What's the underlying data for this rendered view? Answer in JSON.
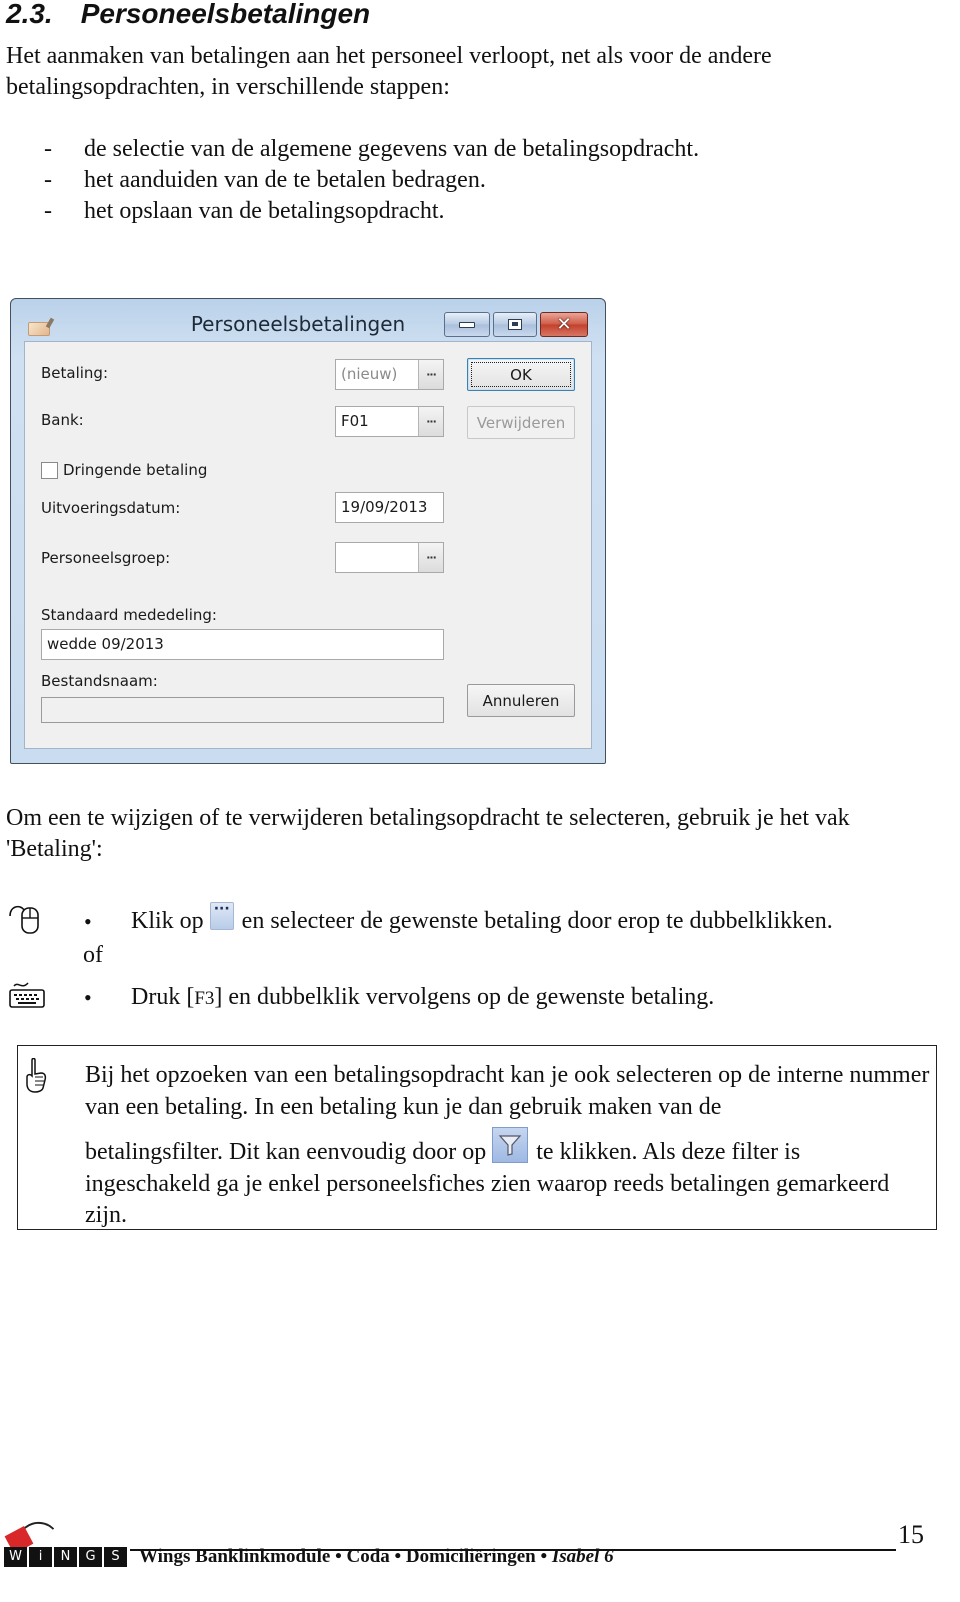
{
  "section": {
    "number": "2.3.",
    "title": "Personeelsbetalingen"
  },
  "intro": "Het aanmaken van betalingen aan het personeel verloopt, net als voor de andere betalingsopdrachten, in verschillende stappen:",
  "steps": [
    {
      "marker": "-",
      "text": "de selectie van de algemene gegevens van de betalingsopdracht."
    },
    {
      "marker": "-",
      "text": "het aanduiden van de te betalen bedragen."
    },
    {
      "marker": "-",
      "text": "het opslaan van de betalingsopdracht."
    }
  ],
  "dialog": {
    "title": "Personeelsbetalingen",
    "icons": {
      "app": "envelope-icon",
      "minimize": "minimize-icon",
      "maximize": "maximize-icon",
      "close": "close-icon",
      "close_glyph": "✕"
    },
    "browse_glyph": "···",
    "fields": {
      "betaling": {
        "label": "Betaling:",
        "value": "(nieuw)"
      },
      "bank": {
        "label": "Bank:",
        "value": "F01"
      },
      "dringend": {
        "label": "Dringende betaling",
        "checked": false
      },
      "uitvoeringsdatum": {
        "label": "Uitvoeringsdatum:",
        "value": "19/09/2013"
      },
      "personeelsgroep": {
        "label": "Personeelsgroep:",
        "value": ""
      },
      "mededeling": {
        "label": "Standaard mededeling:",
        "value": "wedde 09/2013"
      },
      "bestandsnaam": {
        "label": "Bestandsnaam:",
        "value": ""
      }
    },
    "buttons": {
      "ok": "OK",
      "verwijderen": "Verwijderen",
      "annuleren": "Annuleren"
    }
  },
  "select_intro": "Om een te wijzigen of te verwijderen betalingsopdracht te selecteren, gebruik je het vak 'Betaling':",
  "instructions": {
    "mouse": {
      "icon": "mouse-icon",
      "bullet": "•",
      "before": "Klik op",
      "after": "en selecteer de gewenste betaling door erop te dubbelklikken."
    },
    "or": "of",
    "keyboard": {
      "icon": "keyboard-icon",
      "bullet": "•",
      "before": "Druk [",
      "key": "F3",
      "after": "] en dubbelklik vervolgens op de gewenste betaling."
    }
  },
  "note": {
    "icon": "pointing-hand-icon",
    "line1": "Bij het opzoeken van een betalingsopdracht kan je ook selecteren op de interne nummer van een betaling.  In een betaling kun je dan gebruik maken van de",
    "before_icon": "betalingsfilter.  Dit kan eenvoudig door op",
    "after_icon": "te klikken.  Als deze filter is ingeschakeld ga je enkel personeelsfiches zien waarop reeds betalingen gemarkeerd zijn."
  },
  "footer": {
    "logo_letters": [
      "W",
      "i",
      "N",
      "G",
      "S"
    ],
    "text_main": "Wings Banklinkmodule • Coda • Domiciliëringen • ",
    "text_italic": "Isabel 6",
    "page_number": "15"
  }
}
